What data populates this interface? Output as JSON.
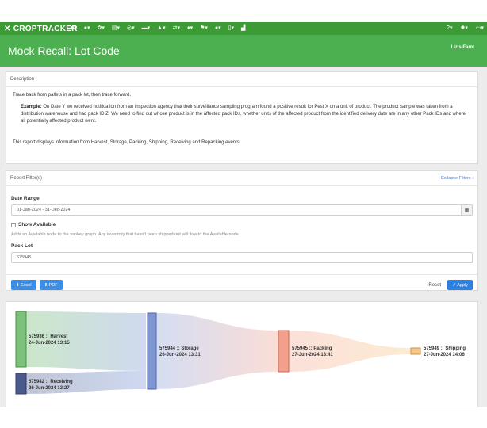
{
  "topnav": {
    "brand": "CROPTRACKER",
    "icons": [
      "bookmark-icon",
      "tag-icon",
      "sprout-icon",
      "clipboard-icon",
      "tractor-icon",
      "truck-icon",
      "person-icon",
      "transfer-icon",
      "pin-icon",
      "flag-icon",
      "location-icon",
      "phone-icon",
      "chart-icon"
    ],
    "right_icons": [
      "help-icon",
      "settings-icon",
      "more-icon"
    ]
  },
  "header": {
    "title": "Mock Recall: Lot Code",
    "farm": "Liz's Farm"
  },
  "description": {
    "heading": "Description",
    "intro": "Trace back from pallets in a pack lot, then trace forward.",
    "example_label": "Example:",
    "example_text": " On Date Y we received notification from an inspection agency that their surveillance sampling program found a positive result for Pest X on a unit of product. The product sample was taken from a distribution warehouse and had pack ID Z. We need to find out whose product is in the affected pack IDs, whether units of the affected product from the identified delivery date are in any other Pack IDs and where all potentially affected product went.",
    "footer": "This report displays information from Harvest, Storage, Packing, Shipping, Receiving and Repacking events."
  },
  "filters": {
    "heading": "Report Filter(s)",
    "collapse": "Collapse Filters",
    "date_range_label": "Date Range",
    "date_range_value": "01-Jan-2024 - 31-Dec-2024",
    "show_available_label": "Show Available",
    "show_available_checked": false,
    "show_available_hint": "Adds an Available node to the sankey graph. Any inventory that hasn't been shipped out will flow to the Available node.",
    "pack_lot_label": "Pack Lot",
    "pack_lot_value": "575945",
    "excel": "Excel",
    "pdf": "PDF",
    "reset": "Reset",
    "apply": "Apply"
  },
  "sankey": {
    "nodes": [
      {
        "id": "harvest",
        "line1": "575936 :: Harvest",
        "line2": "24-Jun-2024 13:15",
        "color": "#7cc27c"
      },
      {
        "id": "receiving",
        "line1": "575942 :: Receiving",
        "line2": "26-Jun-2024 13:27",
        "color": "#4a5a8a"
      },
      {
        "id": "storage",
        "line1": "575944 :: Storage",
        "line2": "26-Jun-2024 13:31",
        "color": "#7f96d0"
      },
      {
        "id": "packing",
        "line1": "575945 :: Packing",
        "line2": "27-Jun-2024 13:41",
        "color": "#f2a08c"
      },
      {
        "id": "shipping",
        "line1": "575949 :: Shipping",
        "line2": "27-Jun-2024 14:06",
        "color": "#f6c98a"
      }
    ]
  }
}
